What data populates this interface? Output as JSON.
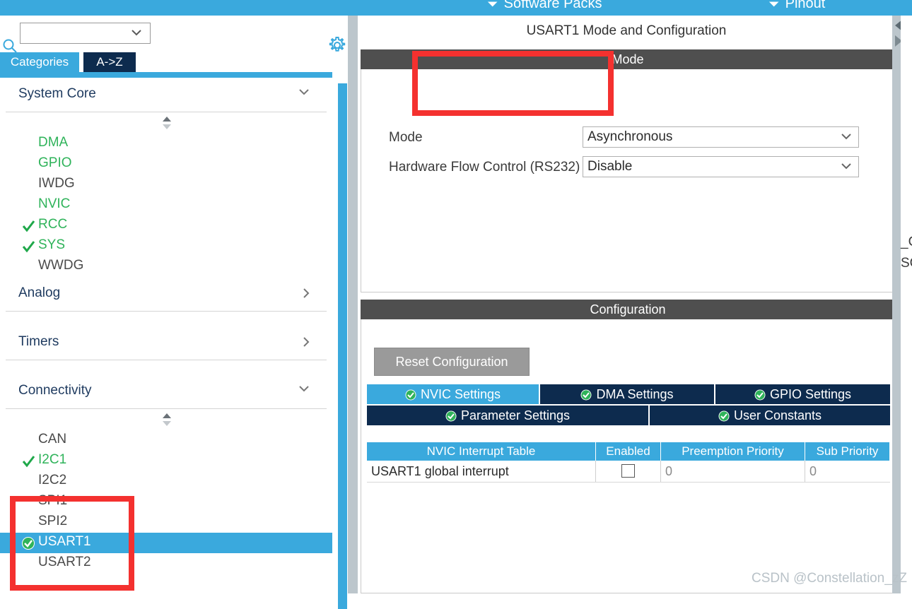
{
  "app": {
    "watermark": "CSDN @Constellation_zZ"
  },
  "topbar": {
    "background": "#3aa9dd",
    "items": [
      {
        "label": "Software Packs",
        "icon": "chevron-down-icon"
      },
      {
        "label": "Pinout",
        "icon": "chevron-down-icon"
      }
    ]
  },
  "sidebar": {
    "search": {
      "value": "",
      "placeholder": "",
      "icon": "search-icon"
    },
    "settings_icon": "gear-icon",
    "tabs": [
      {
        "label": "Categories",
        "active": true
      },
      {
        "label": "A->Z",
        "active": false
      }
    ],
    "sections": [
      {
        "title": "System Core",
        "expanded": true,
        "chevron": "chevron-down-icon",
        "items": [
          {
            "label": "DMA",
            "state": "available",
            "check": false
          },
          {
            "label": "GPIO",
            "state": "available",
            "check": false
          },
          {
            "label": "IWDG",
            "state": "plain",
            "check": false
          },
          {
            "label": "NVIC",
            "state": "available",
            "check": false
          },
          {
            "label": "RCC",
            "state": "available",
            "check": true
          },
          {
            "label": "SYS",
            "state": "available",
            "check": true
          },
          {
            "label": "WWDG",
            "state": "plain",
            "check": false
          }
        ]
      },
      {
        "title": "Analog",
        "expanded": false,
        "chevron": "chevron-right-icon",
        "items": []
      },
      {
        "title": "Timers",
        "expanded": false,
        "chevron": "chevron-right-icon",
        "items": []
      },
      {
        "title": "Connectivity",
        "expanded": true,
        "chevron": "chevron-down-icon",
        "items": [
          {
            "label": "CAN",
            "state": "plain",
            "check": false
          },
          {
            "label": "I2C1",
            "state": "available",
            "check": true
          },
          {
            "label": "I2C2",
            "state": "plain",
            "check": false
          },
          {
            "label": "SPI1",
            "state": "plain",
            "check": false
          },
          {
            "label": "SPI2",
            "state": "plain",
            "check": false
          },
          {
            "label": "USART1",
            "state": "selected",
            "check": true
          },
          {
            "label": "USART2",
            "state": "plain",
            "check": false
          }
        ]
      }
    ]
  },
  "peripheral": {
    "title": "USART1 Mode and Configuration",
    "mode_section": {
      "header": "Mode",
      "fields": [
        {
          "label": "Mode",
          "value": "Asynchronous"
        },
        {
          "label": "Hardware Flow Control (RS232)",
          "value": "Disable"
        }
      ]
    },
    "configuration_section": {
      "header": "Configuration",
      "reset_button": "Reset Configuration",
      "tabs": [
        {
          "label": "NVIC Settings",
          "active": true,
          "icon": "check-circle-icon"
        },
        {
          "label": "DMA Settings",
          "active": false,
          "icon": "check-circle-icon"
        },
        {
          "label": "GPIO Settings",
          "active": false,
          "icon": "check-circle-icon"
        },
        {
          "label": "Parameter Settings",
          "active": false,
          "icon": "check-circle-icon"
        },
        {
          "label": "User Constants",
          "active": false,
          "icon": "check-circle-icon"
        }
      ],
      "table": {
        "columns": [
          "NVIC Interrupt Table",
          "Enabled",
          "Preemption Priority",
          "Sub Priority"
        ],
        "rows": [
          {
            "interrupt": "USART1 global interrupt",
            "enabled": false,
            "preemption_priority": "0",
            "sub_priority": "0"
          }
        ]
      }
    }
  },
  "edge": {
    "text_lines": [
      "_C",
      "SC"
    ]
  },
  "colors": {
    "accent_blue": "#3aa9dd",
    "dark_navy": "#0d2b4e",
    "header_gray": "#4f4f4f",
    "green_ok": "#2fb35a",
    "annotation_red": "#f4312f",
    "divider_gray": "#bcc6cc"
  }
}
